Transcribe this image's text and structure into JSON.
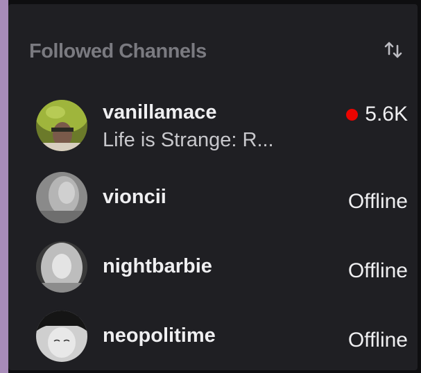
{
  "followed": {
    "title": "Followed Channels",
    "sort_icon": "sort-arrows-icon",
    "channels": [
      {
        "name": "vanillamace",
        "game": "Life is Strange: R...",
        "status": "5.6K",
        "live": true
      },
      {
        "name": "vioncii",
        "game": "",
        "status": "Offline",
        "live": false
      },
      {
        "name": "nightbarbie",
        "game": "",
        "status": "Offline",
        "live": false
      },
      {
        "name": "neopolitime",
        "game": "",
        "status": "Offline",
        "live": false
      }
    ]
  },
  "colors": {
    "accent_bar": "#a78bb8",
    "panel_bg": "#1f1f23",
    "live_dot": "#eb0400",
    "header_text": "#7a7a80"
  }
}
